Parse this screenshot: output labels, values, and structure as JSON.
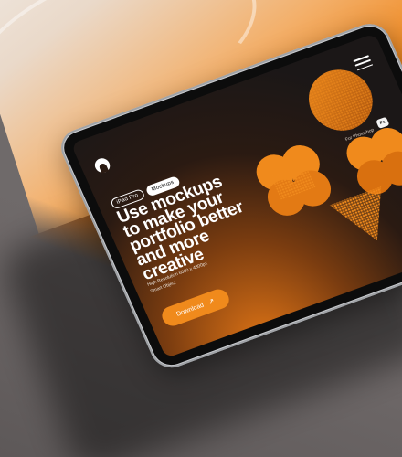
{
  "scene": {
    "colors": {
      "accent": "#f08a1c",
      "screen_dark": "#1b1717",
      "body_silver": "#c9cbcf"
    }
  },
  "screen": {
    "badges": [
      "iPad Pro",
      "Mockups"
    ],
    "headline_lines": [
      "Use mockups",
      "to make your",
      "portfolio better",
      "and more",
      "creative"
    ],
    "specs_lines": [
      "High Resolution 6000 x 4800px",
      "Smart Object"
    ],
    "download_label": "Download",
    "download_icon": "↗",
    "right_label": "For Photoshop",
    "right_icon_text": "Ps"
  }
}
